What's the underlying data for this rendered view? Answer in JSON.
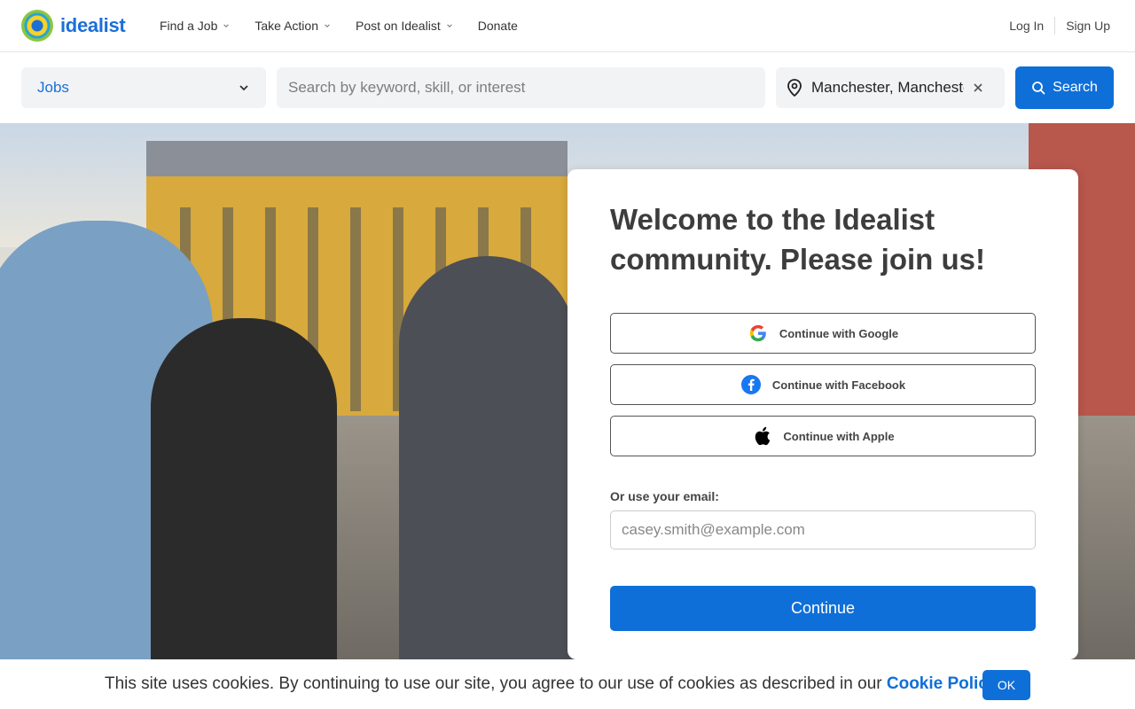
{
  "brand": {
    "name": "idealist",
    "accent": "#1b6fd6"
  },
  "nav": {
    "items": [
      {
        "label": "Find a Job",
        "has_dropdown": true
      },
      {
        "label": "Take Action",
        "has_dropdown": true
      },
      {
        "label": "Post on Idealist",
        "has_dropdown": true
      },
      {
        "label": "Donate",
        "has_dropdown": false
      }
    ],
    "login": "Log In",
    "signup": "Sign Up"
  },
  "search": {
    "type_selected": "Jobs",
    "keyword_placeholder": "Search by keyword, skill, or interest",
    "location_value": "Manchester, Manchester",
    "button_label": "Search"
  },
  "signup_card": {
    "heading": "Welcome to the Idealist community. Please join us!",
    "google_label": "Continue with Google",
    "facebook_label": "Continue with Facebook",
    "apple_label": "Continue with Apple",
    "email_label": "Or use your email:",
    "email_placeholder": "casey.smith@example.com",
    "continue_label": "Continue"
  },
  "cookie_banner": {
    "message": "This site uses cookies. By continuing to use our site, you agree to our use of cookies as described in our ",
    "link_text": "Cookie Policy",
    "suffix": ".",
    "ok_label": "OK"
  },
  "colors": {
    "primary_button": "#0f6fd8",
    "input_bg": "#f2f3f5"
  }
}
